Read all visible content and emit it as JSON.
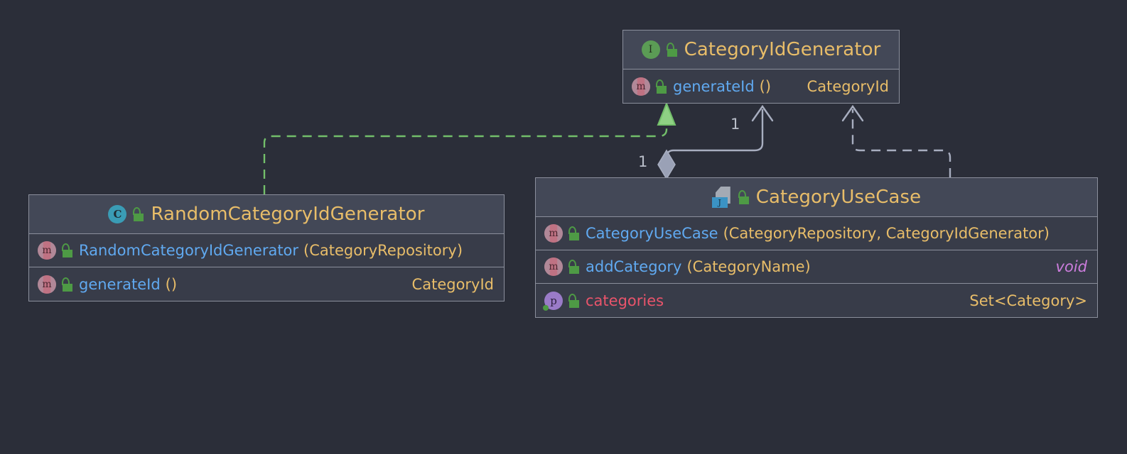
{
  "diagram": {
    "type": "uml-class-diagram",
    "background_color": "#2b2e39",
    "nodes": [
      {
        "id": "category-id-generator",
        "stereotype": "interface",
        "icon": "interface-i-icon",
        "visibility_icon": "unlocked-padlock-icon",
        "title": "CategoryIdGenerator",
        "members": [
          {
            "kind": "method",
            "icon": "method-m-icon",
            "visibility_icon": "unlocked-padlock-icon",
            "name": "generateId",
            "params": "()",
            "type": "CategoryId",
            "type_style": "normal"
          }
        ]
      },
      {
        "id": "random-category-id-generator",
        "stereotype": "class",
        "icon": "class-c-icon",
        "visibility_icon": "unlocked-padlock-icon",
        "title": "RandomCategoryIdGenerator",
        "members": [
          {
            "kind": "method",
            "icon": "method-m-icon",
            "visibility_icon": "unlocked-padlock-icon",
            "name": "RandomCategoryIdGenerator",
            "params": "(CategoryRepository)",
            "type": "",
            "type_style": "normal"
          },
          {
            "kind": "method",
            "icon": "method-m-icon",
            "visibility_icon": "unlocked-padlock-icon",
            "name": "generateId",
            "params": "()",
            "type": "CategoryId",
            "type_style": "normal"
          }
        ]
      },
      {
        "id": "category-use-case",
        "stereotype": "java-class",
        "icon": "java-file-icon",
        "visibility_icon": "unlocked-padlock-icon",
        "title": "CategoryUseCase",
        "members": [
          {
            "kind": "method",
            "icon": "method-m-icon",
            "visibility_icon": "unlocked-padlock-icon",
            "name": "CategoryUseCase",
            "params": "(CategoryRepository, CategoryIdGenerator)",
            "type": "",
            "type_style": "normal"
          },
          {
            "kind": "method",
            "icon": "method-m-icon",
            "visibility_icon": "unlocked-padlock-icon",
            "name": "addCategory",
            "params": "(CategoryName)",
            "type": "void",
            "type_style": "keyword"
          },
          {
            "kind": "property",
            "icon": "property-p-icon",
            "visibility_icon": "unlocked-padlock-icon",
            "name": "categories",
            "params": "",
            "type": "Set<Category>",
            "type_style": "normal"
          }
        ]
      }
    ],
    "edges": [
      {
        "id": "realization-edge",
        "kind": "realization",
        "style": "dashed",
        "color": "#73bf6a",
        "arrow": "closed-triangle",
        "from": "random-category-id-generator",
        "to": "category-id-generator",
        "source_label": "",
        "target_label": ""
      },
      {
        "id": "aggregation-edge",
        "kind": "aggregation",
        "style": "solid",
        "color": "#a8aec0",
        "arrow": "open-arrow",
        "from": "category-use-case",
        "to": "category-id-generator",
        "source_label": "1",
        "target_label": "1"
      },
      {
        "id": "dependency-edge",
        "kind": "dependency",
        "style": "dashed",
        "color": "#a8aec0",
        "arrow": "open-arrow",
        "from": "category-use-case",
        "to": "category-id-generator",
        "source_label": "",
        "target_label": ""
      }
    ],
    "colors": {
      "node_header": "#434857",
      "node_body": "#383c49",
      "node_border": "#8b8f9c",
      "title_text": "#e8bd69",
      "member_name": "#60a9f0",
      "field_name": "#e9546b",
      "type_text": "#e8bd69",
      "keyword_text": "#cc7ddd",
      "realization_line": "#73bf6a",
      "relation_line": "#a8aec0"
    }
  }
}
